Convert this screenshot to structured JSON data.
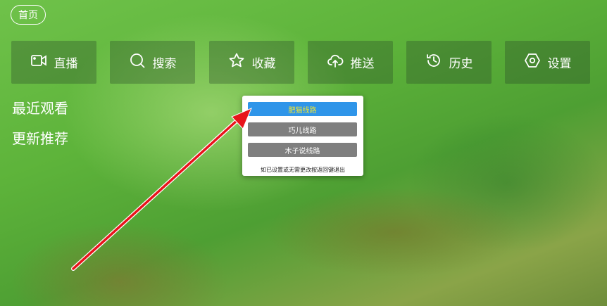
{
  "home_tab": "首页",
  "nav": [
    {
      "label": "直播",
      "icon": "video-camera-icon"
    },
    {
      "label": "搜索",
      "icon": "search-icon"
    },
    {
      "label": "收藏",
      "icon": "star-icon"
    },
    {
      "label": "推送",
      "icon": "cloud-upload-icon"
    },
    {
      "label": "历史",
      "icon": "history-icon"
    },
    {
      "label": "设置",
      "icon": "settings-hexagon-icon"
    }
  ],
  "sections": {
    "recent": "最近观看",
    "recommend": "更新推荐"
  },
  "dialog": {
    "options": [
      "肥猫线路",
      "巧儿线路",
      "木子说线路"
    ],
    "selected_index": 0,
    "hint": "如已设置或无需更改按返回键退出"
  },
  "colors": {
    "active_option_bg": "#2f95e9",
    "active_option_text": "#f4e62f",
    "option_bg": "#7f7f7f",
    "annotation_arrow": "#e8141b"
  }
}
